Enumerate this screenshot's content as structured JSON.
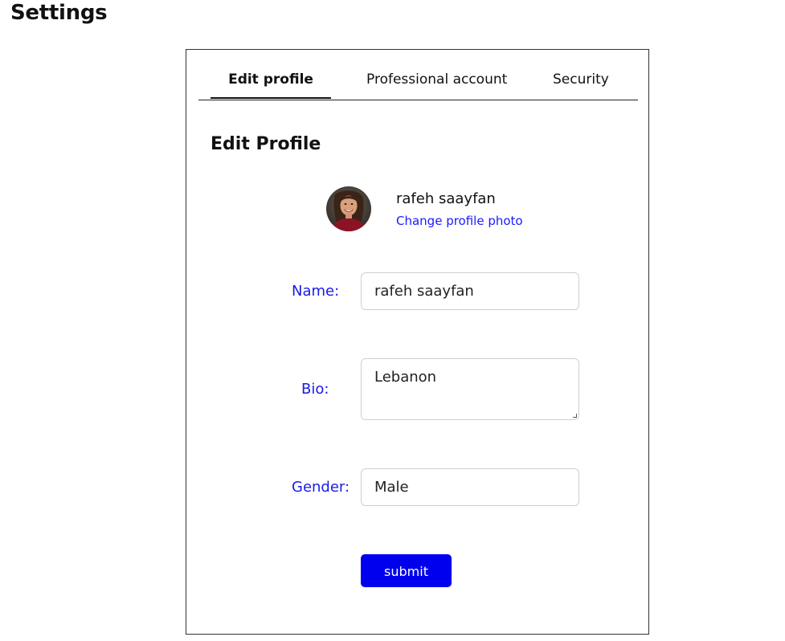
{
  "page": {
    "title": "Settings"
  },
  "tabs": [
    {
      "label": "Edit profile",
      "active": true
    },
    {
      "label": "Professional account",
      "active": false
    },
    {
      "label": "Security",
      "active": false
    }
  ],
  "edit_profile": {
    "heading": "Edit Profile",
    "user_name": "rafeh saayfan",
    "change_photo_label": "Change profile photo",
    "avatar_icon": "profile-photo"
  },
  "form": {
    "name_label": "Name:",
    "name_value": "rafeh saayfan",
    "bio_label": "Bio:",
    "bio_value": "Lebanon",
    "gender_label": "Gender:",
    "gender_value": "Male",
    "submit_label": "submit"
  },
  "colors": {
    "accent": "#0000ee",
    "label": "#1a1ae6",
    "link": "#1a1aff",
    "border": "#cfcfcf"
  }
}
